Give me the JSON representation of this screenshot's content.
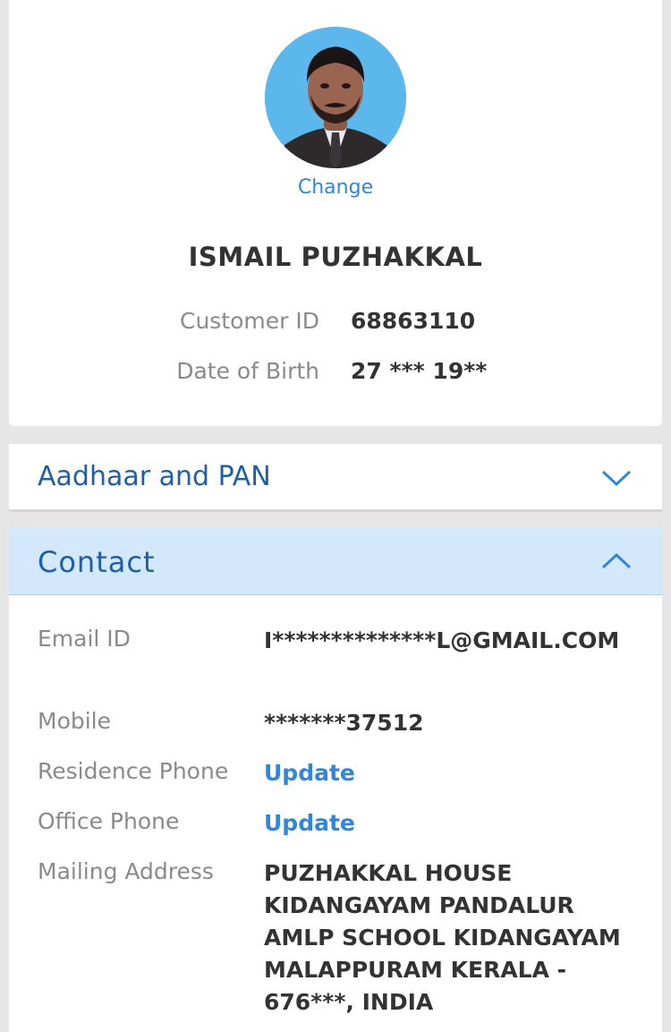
{
  "profile": {
    "change_label": "Change",
    "name": "ISMAIL PUZHAKKAL",
    "customer_id_label": "Customer ID",
    "customer_id": "68863110",
    "dob_label": "Date of Birth",
    "dob": "27 *** 19**"
  },
  "sections": {
    "aadhaar": {
      "title": "Aadhaar and PAN",
      "icon": "chevron-down-icon"
    },
    "contact": {
      "title": "Contact",
      "icon": "chevron-up-icon"
    }
  },
  "contact": {
    "email_label": "Email ID",
    "email": "I**************L@GMAIL.COM",
    "mobile_label": "Mobile",
    "mobile": "*******37512",
    "residence_label": "Residence Phone",
    "residence_action": "Update",
    "office_label": "Office Phone",
    "office_action": "Update",
    "address_label": "Mailing Address",
    "address": "PUZHAKKAL HOUSE KIDANGAYAM PANDALUR AMLP SCHOOL KIDANGAYAM MALAPPURAM KERALA - 676***, INDIA"
  },
  "colors": {
    "accent": "#2f86e0",
    "section_title": "#1f5ea8",
    "expanded_header": "#d3e8fb",
    "background": "#e6e6e6"
  }
}
